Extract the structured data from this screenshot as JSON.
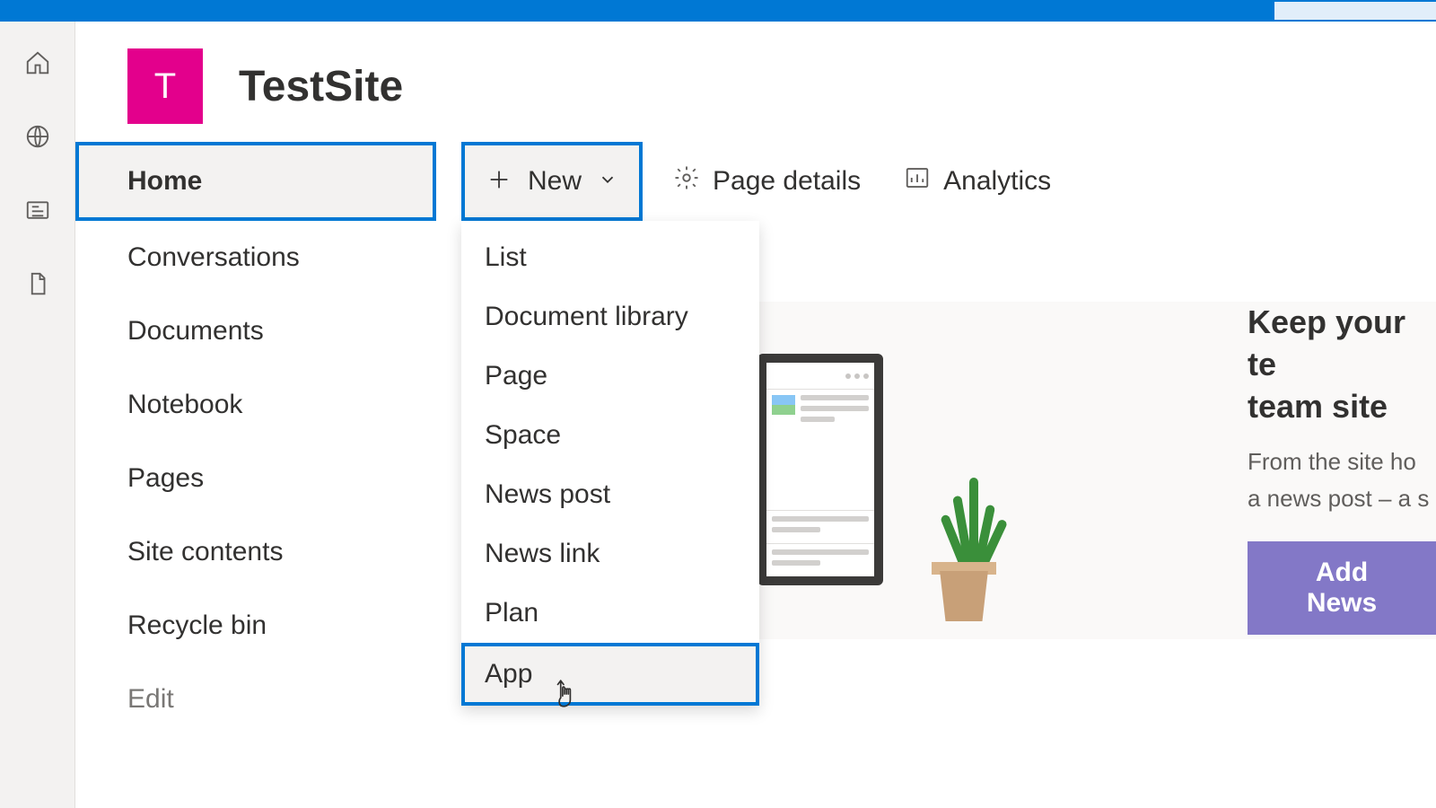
{
  "site": {
    "initial": "T",
    "title": "TestSite",
    "accent": "#e3008c"
  },
  "nav": {
    "items": [
      "Home",
      "Conversations",
      "Documents",
      "Notebook",
      "Pages",
      "Site contents",
      "Recycle bin"
    ],
    "edit": "Edit"
  },
  "commands": {
    "new_label": "New",
    "page_details": "Page details",
    "analytics": "Analytics"
  },
  "new_menu": {
    "items": [
      "List",
      "Document library",
      "Page",
      "Space",
      "News post",
      "News link",
      "Plan",
      "App"
    ]
  },
  "news": {
    "heading1": "Keep your te",
    "heading2": "team site",
    "body1": "From the site ho",
    "body2": "a news post – a s",
    "button": "Add News"
  }
}
